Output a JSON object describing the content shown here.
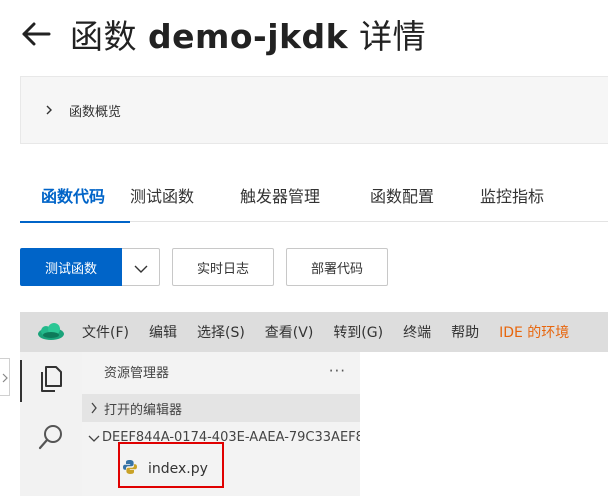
{
  "header": {
    "title_prefix": "函数",
    "function_name": "demo-jkdk",
    "title_suffix": "详情"
  },
  "overview": {
    "label": "函数概览"
  },
  "tabs": [
    {
      "label": "函数代码",
      "active": true
    },
    {
      "label": "测试函数",
      "active": false
    },
    {
      "label": "触发器管理",
      "active": false
    },
    {
      "label": "函数配置",
      "active": false
    },
    {
      "label": "监控指标",
      "active": false
    }
  ],
  "actions": {
    "test_label": "测试函数",
    "log_label": "实时日志",
    "deploy_label": "部署代码"
  },
  "ide": {
    "menu": [
      "文件(F)",
      "编辑",
      "选择(S)",
      "查看(V)",
      "转到(G)",
      "终端",
      "帮助"
    ],
    "notice": "IDE 的环境",
    "explorer_title": "资源管理器",
    "explorer_more": "···",
    "open_editors": "打开的编辑器",
    "folder": "DEEF844A-0174-403E-AAEA-79C33AEF8",
    "file": "index.py"
  },
  "colors": {
    "primary": "#0064c8",
    "highlight": "#e00000",
    "notice": "#e8660d"
  },
  "icons": {
    "back": "arrow-left-icon",
    "files": "files-icon",
    "search": "search-icon",
    "python": "python-icon"
  }
}
